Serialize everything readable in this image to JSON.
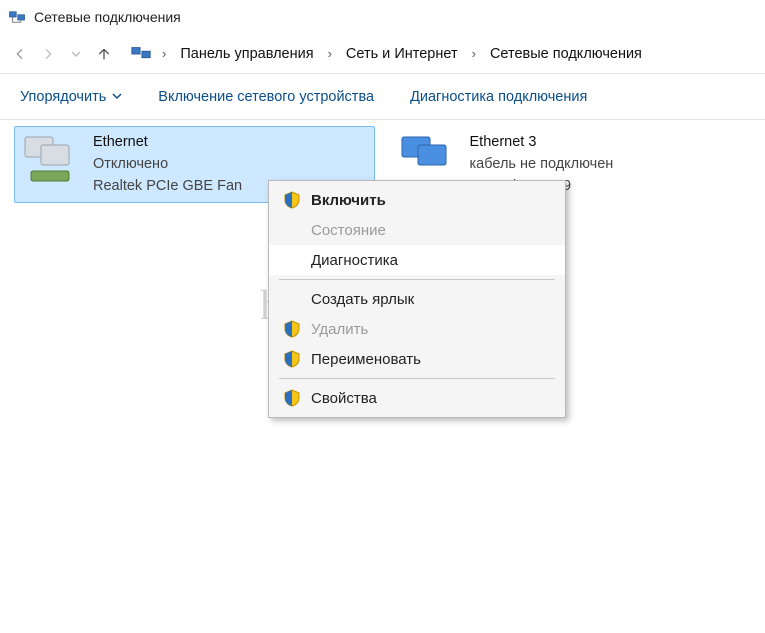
{
  "window": {
    "title": "Сетевые подключения"
  },
  "breadcrumbs": {
    "items": [
      "Панель управления",
      "Сеть и Интернет",
      "Сетевые подключения"
    ]
  },
  "toolbar": {
    "organize": "Упорядочить",
    "enable_device": "Включение сетевого устройства",
    "diagnose": "Диагностика подключения"
  },
  "adapters": [
    {
      "name": "Ethernet",
      "status": "Отключено",
      "device": "Realtek PCIe GBE Fan",
      "selected": true
    },
    {
      "name": "Ethernet 3",
      "status": "кабель не подключен",
      "device": "ows Adapter V9",
      "selected": false
    }
  ],
  "context_menu": {
    "enable": "Включить",
    "state": "Состояние",
    "diagnostics": "Диагностика",
    "create_shortcut": "Создать ярлык",
    "delete": "Удалить",
    "rename": "Переименовать",
    "properties": "Свойства"
  },
  "watermark": "help-wifi.ru"
}
